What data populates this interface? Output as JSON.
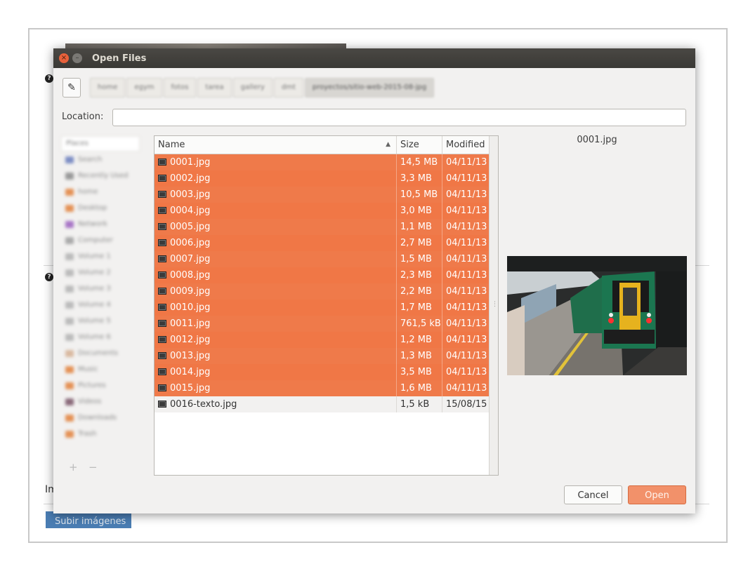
{
  "background_page": {
    "help_icon": "?",
    "partial_label": "Im",
    "submit_button": "Subir imágenes"
  },
  "dialog": {
    "title": "Open Files",
    "close_icon": "×",
    "minimize_icon": "–",
    "edit_location_icon": "✎",
    "pathbar": [
      "home",
      "egym",
      "fotos",
      "tarea",
      "gallery",
      "dmt",
      "proyectos/sitio-web-2015-08-jpg"
    ],
    "location_label": "Location:",
    "location_value": "",
    "places": {
      "header": "Places",
      "items": [
        "Search",
        "Recently Used",
        "home",
        "Desktop",
        "Network",
        "Computer",
        "Volume 1",
        "Volume 2",
        "Volume 3",
        "Volume 4",
        "Volume 5",
        "Volume 6",
        "Documents",
        "Music",
        "Pictures",
        "Videos",
        "Downloads",
        "Trash"
      ],
      "add_icon": "+",
      "remove_icon": "−"
    },
    "columns": {
      "name": "Name",
      "size": "Size",
      "modified": "Modified",
      "sort_icon": "▲"
    },
    "files": [
      {
        "name": "0001.jpg",
        "size": "14,5 MB",
        "modified": "04/11/13",
        "selected": true
      },
      {
        "name": "0002.jpg",
        "size": "3,3 MB",
        "modified": "04/11/13",
        "selected": true
      },
      {
        "name": "0003.jpg",
        "size": "10,5 MB",
        "modified": "04/11/13",
        "selected": true
      },
      {
        "name": "0004.jpg",
        "size": "3,0 MB",
        "modified": "04/11/13",
        "selected": true
      },
      {
        "name": "0005.jpg",
        "size": "1,1 MB",
        "modified": "04/11/13",
        "selected": true
      },
      {
        "name": "0006.jpg",
        "size": "2,7 MB",
        "modified": "04/11/13",
        "selected": true
      },
      {
        "name": "0007.jpg",
        "size": "1,5 MB",
        "modified": "04/11/13",
        "selected": true
      },
      {
        "name": "0008.jpg",
        "size": "2,3 MB",
        "modified": "04/11/13",
        "selected": true
      },
      {
        "name": "0009.jpg",
        "size": "2,2 MB",
        "modified": "04/11/13",
        "selected": true
      },
      {
        "name": "0010.jpg",
        "size": "1,7 MB",
        "modified": "04/11/13",
        "selected": true
      },
      {
        "name": "0011.jpg",
        "size": "761,5 kB",
        "modified": "04/11/13",
        "selected": true
      },
      {
        "name": "0012.jpg",
        "size": "1,2 MB",
        "modified": "04/11/13",
        "selected": true
      },
      {
        "name": "0013.jpg",
        "size": "1,3 MB",
        "modified": "04/11/13",
        "selected": true
      },
      {
        "name": "0014.jpg",
        "size": "3,5 MB",
        "modified": "04/11/13",
        "selected": true
      },
      {
        "name": "0015.jpg",
        "size": "1,6 MB",
        "modified": "04/11/13",
        "selected": true
      },
      {
        "name": "0016-texto.jpg",
        "size": "1,5 kB",
        "modified": "15/08/15",
        "selected": false
      }
    ],
    "preview": {
      "filename": "0001.jpg"
    },
    "buttons": {
      "cancel": "Cancel",
      "open": "Open"
    }
  },
  "colors": {
    "selection": "#f07746",
    "titlebar": "#3f3e3a",
    "accent_close": "#e8613b"
  },
  "icons": {
    "file": "image-file-icon",
    "edit": "pencil-icon"
  }
}
